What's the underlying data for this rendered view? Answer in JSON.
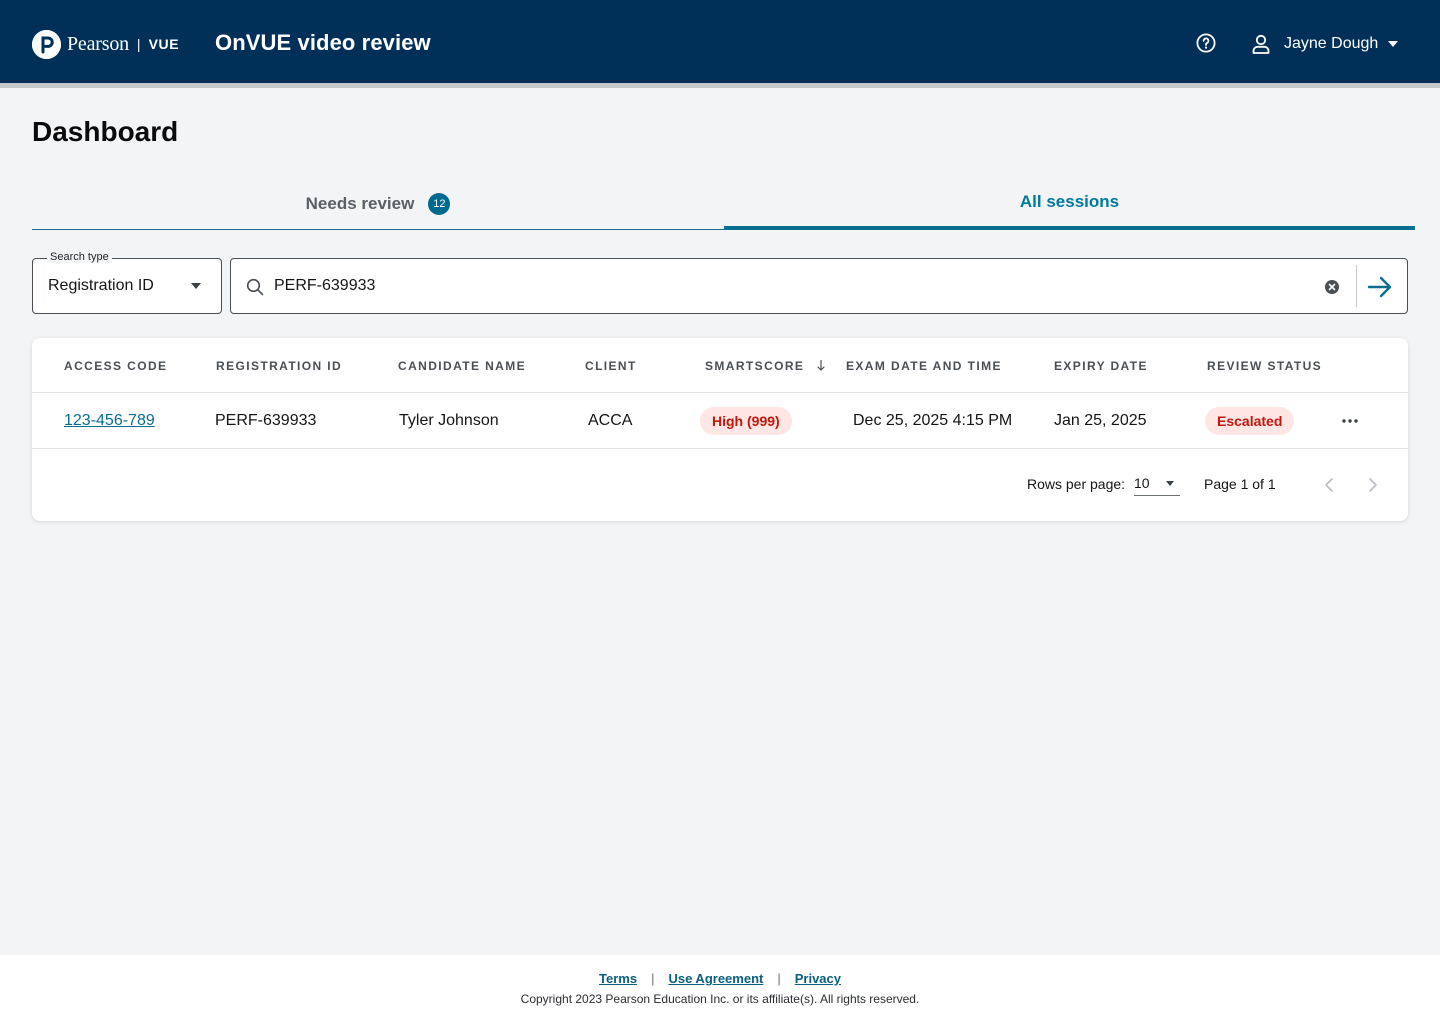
{
  "header": {
    "brand_name": "Pearson",
    "brand_separator": "|",
    "brand_product": "VUE",
    "app_title": "OnVUE video review",
    "help_icon": "help-circle-icon",
    "user_name": "Jayne Dough",
    "user_icon": "user-icon",
    "background_color": "#003057"
  },
  "page": {
    "title": "Dashboard"
  },
  "tabs": [
    {
      "label": "Needs review",
      "badge": "12",
      "selected": false
    },
    {
      "label": "All sessions",
      "selected": true
    }
  ],
  "search": {
    "type_label": "Search type",
    "type_value": "Registration ID",
    "query": "PERF-639933",
    "search_icon": "search-icon",
    "clear_icon": "clear-circle-icon",
    "submit_icon": "arrow-right-icon"
  },
  "table": {
    "columns": [
      "ACCESS CODE",
      "REGISTRATION ID",
      "CANDIDATE NAME",
      "CLIENT",
      "SMARTSCORE",
      "EXAM DATE AND TIME",
      "EXPIRY DATE",
      "REVIEW STATUS"
    ],
    "sorted_column": "SMARTSCORE",
    "sort_direction": "descending",
    "rows": [
      {
        "access_code": "123-456-789",
        "registration_id": "PERF-639933",
        "candidate_name": "Tyler Johnson",
        "client": "ACCA",
        "smartscore": "High (999)",
        "exam_datetime": "Dec 25, 2025 4:15 PM",
        "expiry_date": "Jan 25, 2025",
        "review_status": "Escalated"
      }
    ]
  },
  "pagination": {
    "rows_per_page_label": "Rows per page:",
    "rows_per_page_value": "10",
    "page_label": "Page 1 of 1"
  },
  "footer": {
    "links": [
      "Terms",
      "Use Agreement",
      "Privacy"
    ],
    "separator": "|",
    "copyright": "Copyright 2023 Pearson Education Inc. or its affiliate(s). All rights reserved."
  },
  "colors": {
    "accent": "#007a9c",
    "alert_bg": "#fde6e4",
    "alert_text": "#c0180c"
  }
}
